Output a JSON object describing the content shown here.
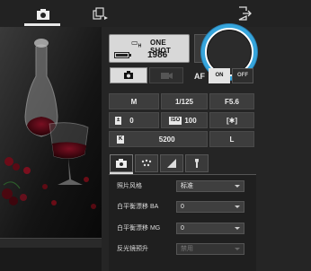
{
  "topbar": {
    "camera_tab_icon": "camera-icon",
    "playback_tab_icon": "playback-icon",
    "exit_icon": "exit-icon"
  },
  "liveview": {
    "nav_buttons": [
      "<",
      "<",
      ">",
      "»",
      "»»"
    ]
  },
  "status": {
    "drive_icon": "continuous-drive-icon",
    "af_mode": "ONE SHOT",
    "shots_remaining": "1986",
    "battery_level": 0.9
  },
  "capture": {
    "still_icon": "camera-icon",
    "movie_icon": "movie-camera-icon",
    "af_label": "AF",
    "af_on": "ON",
    "af_off": "OFF"
  },
  "exposure": {
    "mode": "M",
    "shutter": "1/125",
    "aperture": "F5.6",
    "exp_comp_icon": "exposure-compensation-icon",
    "exp_comp": "0",
    "iso_badge": "ISO",
    "iso": "100",
    "metering_icon": "metering-icon",
    "wb_badge": "K",
    "wb_kelvin": "5200",
    "quality": "L"
  },
  "settings_tabs": [
    "camera-icon",
    "dots-icon",
    "half-shade-icon",
    "wrench-icon"
  ],
  "settings": [
    {
      "label": "照片风格",
      "value": "标准",
      "disabled": false
    },
    {
      "label": "白平衡漂移 BA",
      "value": "0",
      "disabled": false
    },
    {
      "label": "白平衡漂移 MG",
      "value": "0",
      "disabled": false
    },
    {
      "label": "反光镜预升",
      "value": "禁用",
      "disabled": true
    }
  ],
  "colors": {
    "accent": "#36a5dc",
    "background": "#252525"
  }
}
